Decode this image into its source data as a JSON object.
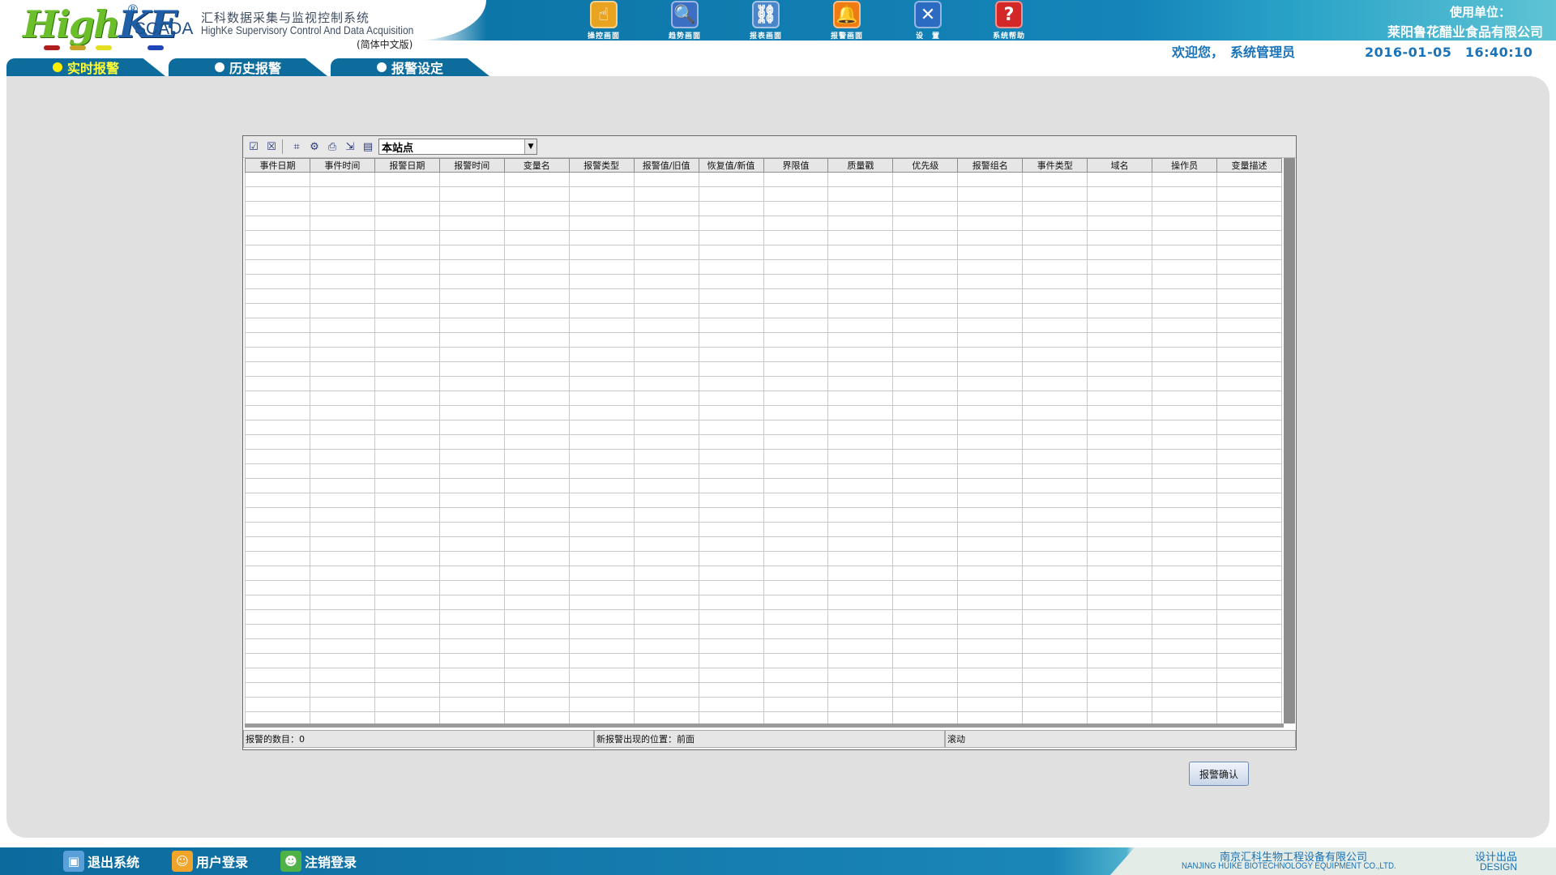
{
  "header": {
    "logo": {
      "brand_high": "High",
      "brand_ke": "KE",
      "reg": "®",
      "scada": "SCADA",
      "cn_title": "汇科数据采集与监视控制系统",
      "en_title": "HighKe Supervisory Control And Data Acquisition",
      "edition": "(简体中文版)"
    },
    "toolbar": [
      {
        "label": "操控画面",
        "icon": "hand-pointer-icon",
        "color": "#e8a321"
      },
      {
        "label": "趋势画面",
        "icon": "magnifier-trend-icon",
        "color": "#3a6fc4"
      },
      {
        "label": "报表画面",
        "icon": "report-chain-icon",
        "color": "#4a86c8"
      },
      {
        "label": "报警画面",
        "icon": "alarm-bell-icon",
        "color": "#f07b12"
      },
      {
        "label": "设　置",
        "icon": "tools-cross-icon",
        "color": "#2b6cc2"
      },
      {
        "label": "系统帮助",
        "icon": "help-question-icon",
        "color": "#d42727"
      }
    ],
    "org_label": "使用单位：",
    "org_name": "莱阳鲁花醋业食品有限公司",
    "welcome": "欢迎您，　系统管理员",
    "datetime": "2016-01-05　16:40:10"
  },
  "tabs": [
    {
      "label": "实时报警",
      "active": true
    },
    {
      "label": "历史报警",
      "active": false
    },
    {
      "label": "报警设定",
      "active": false
    }
  ],
  "alarm_panel": {
    "station_selected": "本站点",
    "toolbar_icons": [
      "checkbox-check-icon",
      "checkbox-cross-icon",
      "select-region-icon",
      "filter-icon",
      "print-icon",
      "export-icon",
      "save-icon"
    ],
    "columns": [
      "事件日期",
      "事件时间",
      "报警日期",
      "报警时间",
      "变量名",
      "报警类型",
      "报警值/旧值",
      "恢复值/新值",
      "界限值",
      "质量戳",
      "优先级",
      "报警组名",
      "事件类型",
      "域名",
      "操作员",
      "变量描述"
    ],
    "status": {
      "count": "报警的数目：0",
      "position": "新报警出现的位置：前面",
      "scroll": "滚动"
    },
    "confirm_button": "报警确认"
  },
  "footer": {
    "buttons": [
      {
        "label": "退出系统",
        "icon": "exit-cube-icon"
      },
      {
        "label": "用户登录",
        "icon": "user-login-icon"
      },
      {
        "label": "注销登录",
        "icon": "user-logout-icon"
      }
    ],
    "company_cn": "南京汇科生物工程设备有限公司",
    "company_en": "NANJING HUIKE BIOTECHNOLOGY EQUIPMENT CO.,LTD.",
    "design_cn": "设计出品",
    "design_en": "DESIGN"
  },
  "colors": {
    "header_blue": "#0d76a8",
    "tab_blue": "#0e6c9d",
    "active_tab_text": "#ffff33",
    "panel_gray": "#e0e0e0",
    "welcome_blue": "#1a73b8"
  }
}
